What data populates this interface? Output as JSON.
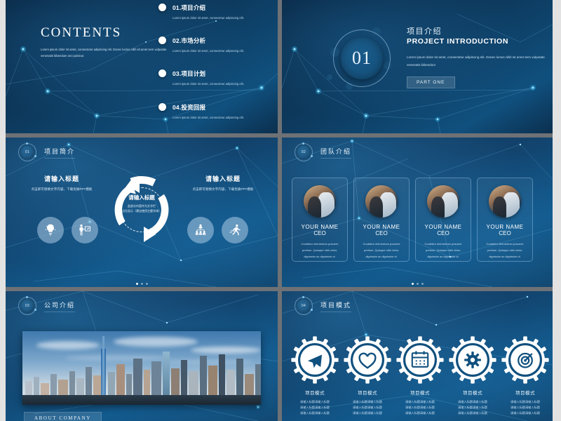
{
  "deck": {
    "slides": [
      {
        "id": "contents",
        "title": "CONTENTS",
        "description": "Lorem ipsum dolor sit amet, consectetur adipiscing elit. Donec luctus nibh sit amet sem vulputate venenatis bibendum orci pulvinar.",
        "items": [
          {
            "num": "01.",
            "label": "项目介绍",
            "sub": "Lorem ipsum dolor sit amet, consectetur adipiscing elit."
          },
          {
            "num": "02.",
            "label": "市场分析",
            "sub": "Lorem ipsum dolor sit amet, consectetur adipiscing elit."
          },
          {
            "num": "03.",
            "label": "项目计划",
            "sub": "Lorem ipsum dolor sit amet, consectetur adipiscing elit."
          },
          {
            "num": "04.",
            "label": "投资回报",
            "sub": "Lorem ipsum dolor sit amet, consectetur adipiscing elit."
          }
        ]
      },
      {
        "id": "section-cover",
        "number": "01",
        "title_cn": "项目介绍",
        "title_en": "PROJECT INTRODUCTION",
        "paragraph": "Lorem ipsum dolor sit amet, consectetur adipiscing elit. Donec luctus nibh sit amet sem vulputate venenatis bibendum",
        "button": "PART ONE"
      },
      {
        "id": "project-brief",
        "header": {
          "badge": "01",
          "title": "项目简介"
        },
        "left": {
          "title": "请输入标题",
          "body": "点击即可替换文字内容，下载优质PPT模板"
        },
        "right": {
          "title": "请输入标题",
          "body": "点击即可替换文字内容，下载优质PPT模板"
        },
        "center": {
          "title": "请输入标题",
          "body": "此部分内容作为文字栏\n断点位显示（建议使用主题字体）。"
        },
        "icons": [
          "lightbulb-icon",
          "presenter-icon",
          "org-chart-icon",
          "runner-icon"
        ]
      },
      {
        "id": "team",
        "header": {
          "badge": "02",
          "title": "团队介绍"
        },
        "members": [
          {
            "name": "YOUR NAME",
            "role": "CEO",
            "desc": "Curabitur elementum posuere pretium. Quisque nibh dolor, dignissim ac dignissim ut."
          },
          {
            "name": "YOUR NAME",
            "role": "CEO",
            "desc": "Curabitur elementum posuere pretium. Quisque nibh dolor, dignissim ac dignissim ut."
          },
          {
            "name": "YOUR NAME",
            "role": "CEO",
            "desc": "Curabitur elementum posuere pretium. Quisque nibh dolor, dignissim ac dignissim ut."
          },
          {
            "name": "YOUR NAME",
            "role": "CEO",
            "desc": "Curabitur elementum posuere pretium. Quisque nibh dolor, dignissim ac dignissim ut."
          }
        ]
      },
      {
        "id": "company",
        "header": {
          "badge": "03",
          "title": "公司介绍"
        },
        "image_caption": "city-skyline-photo",
        "button": "ABOUT COMPANY"
      },
      {
        "id": "project-mode",
        "header": {
          "badge": "04",
          "title": "项目模式"
        },
        "gears": [
          {
            "icon": "paper-plane-icon",
            "title": "项目模式",
            "body": "请输入标题请输入标题\n请输入标题请输入标题\n请输入标题请输入标题"
          },
          {
            "icon": "heart-icon",
            "title": "项目模式",
            "body": "请输入标题请输入标题\n请输入标题请输入标题\n请输入标题请输入标题"
          },
          {
            "icon": "calendar-icon",
            "title": "项目模式",
            "body": "请输入标题请输入标题\n请输入标题请输入标题\n请输入标题请输入标题"
          },
          {
            "icon": "gear-icon",
            "title": "项目模式",
            "body": "请输入标题请输入标题\n请输入标题请输入标题\n请输入标题请输入标题"
          },
          {
            "icon": "target-icon",
            "title": "项目模式",
            "body": "请输入标题请输入标题\n请输入标题请输入标题\n请输入标题请输入标题"
          }
        ]
      }
    ]
  },
  "colors": {
    "deep_blue": "#0d2f50",
    "mid_blue": "#11598c",
    "accent_cyan": "#35c8ff",
    "gap_gray": "#6e7175",
    "page_bg": "#e2e2e2"
  }
}
